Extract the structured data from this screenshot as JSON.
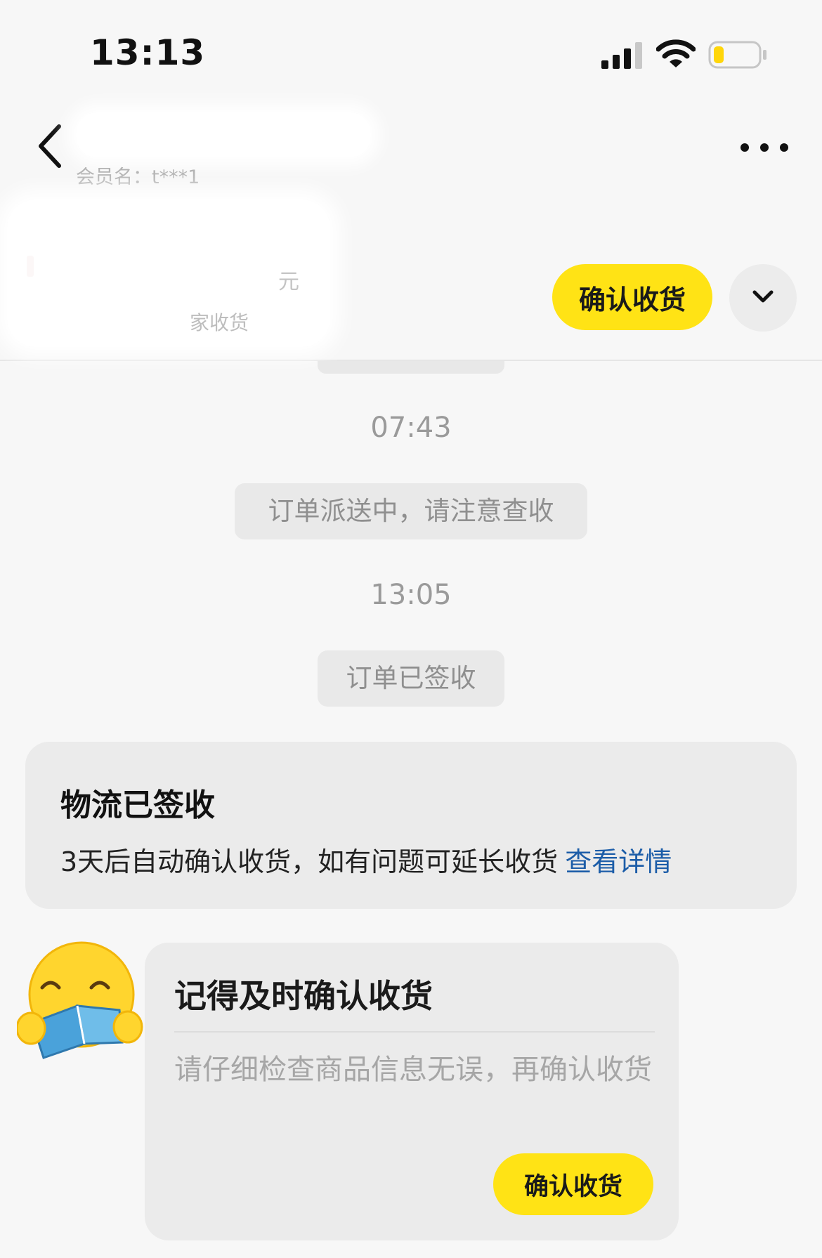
{
  "status_bar": {
    "time": "13:13"
  },
  "nav": {
    "member_label": "会员名：t***1",
    "icons": {
      "back": "chevron-left-icon",
      "more": "more-dots-icon"
    }
  },
  "order_bar": {
    "price_fragment": "元",
    "status_fragment": "家收货",
    "confirm_label": "确认收货",
    "icons": {
      "expand": "chevron-down-icon"
    }
  },
  "messages": [
    {
      "time": "07:43",
      "notice": "订单派送中，请注意查收"
    },
    {
      "time": "13:05",
      "notice": "订单已签收"
    }
  ],
  "logistics_card": {
    "title": "物流已签收",
    "desc": "3天后自动确认收货，如有问题可延长收货",
    "link": "查看详情"
  },
  "reminder_card": {
    "title": "记得及时确认收货",
    "text": "请仔细检查商品信息无误，再确认收货",
    "button_label": "确认收货",
    "avatar_icon": "reading-emoji-icon"
  },
  "colors": {
    "accent_yellow": "#ffe315",
    "link_blue": "#1c5da8",
    "background": "#f7f7f7",
    "card": "#ebebeb"
  }
}
